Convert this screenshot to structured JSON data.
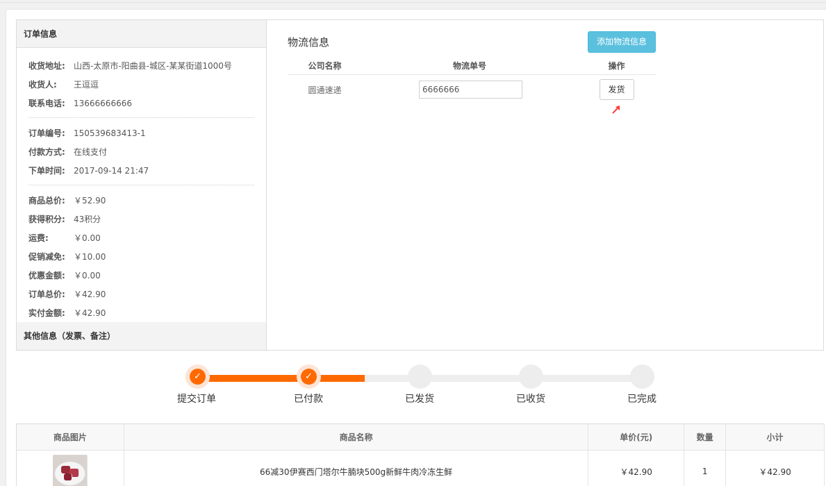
{
  "order_info": {
    "title": "订单信息",
    "group1": [
      {
        "label": "收货地址:",
        "value": "山西-太原市-阳曲县-城区-某某街道1000号"
      },
      {
        "label": "收货人:",
        "value": "王逗逗"
      },
      {
        "label": "联系电话:",
        "value": "13666666666"
      }
    ],
    "group2": [
      {
        "label": "订单编号:",
        "value": "150539683413-1"
      },
      {
        "label": "付款方式:",
        "value": "在线支付"
      },
      {
        "label": "下单时间:",
        "value": "2017-09-14 21:47"
      }
    ],
    "group3": [
      {
        "label": "商品总价:",
        "value": "￥52.90"
      },
      {
        "label": "获得积分:",
        "value": "43积分"
      },
      {
        "label": "运费:",
        "value": "￥0.00"
      },
      {
        "label": "促销减免:",
        "value": "￥10.00"
      },
      {
        "label": "优惠金额:",
        "value": "￥0.00"
      },
      {
        "label": "订单总价:",
        "value": "￥42.90"
      },
      {
        "label": "实付金额:",
        "value": "￥42.90"
      }
    ],
    "other_title": "其他信息（发票、备注）"
  },
  "logistics": {
    "title": "物流信息",
    "add_button": "添加物流信息",
    "columns": [
      "公司名称",
      "物流单号",
      "操作"
    ],
    "row": {
      "company": "圆通速递",
      "tracking_no": "6666666",
      "action": "发货"
    },
    "arrow_color": "#ff3b3b"
  },
  "progress": {
    "steps": [
      {
        "label": "提交订单",
        "done": true
      },
      {
        "label": "已付款",
        "done": true
      },
      {
        "label": "已发货",
        "done": false
      },
      {
        "label": "已收货",
        "done": false
      },
      {
        "label": "已完成",
        "done": false
      }
    ],
    "accent": "#ff6a00"
  },
  "goods": {
    "columns": [
      "商品图片",
      "商品名称",
      "单价(元)",
      "数量",
      "小计"
    ],
    "rows": [
      {
        "image": "beef-dish-image",
        "name": "66减30伊赛西门塔尔牛腩块500g新鲜牛肉冷冻生鲜",
        "price": "￥42.90",
        "qty": "1",
        "subtotal": "￥42.90"
      }
    ]
  }
}
